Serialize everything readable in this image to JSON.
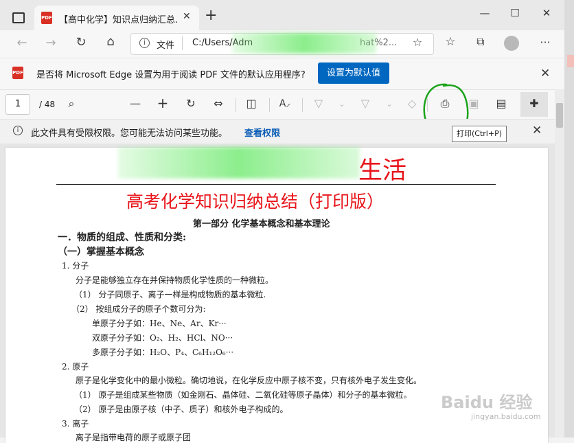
{
  "tab": {
    "title": "【高中化学】知识点归纳汇总.pdf",
    "new_tab": "+"
  },
  "window": {
    "minimize": "—",
    "maximize": "☐",
    "close": "✕"
  },
  "nav": {
    "back": "←",
    "forward": "→",
    "refresh": "↻",
    "home": "⌂",
    "file_label": "文件",
    "url": "C:/Users/Adm",
    "url_tail": "hat%2..."
  },
  "infobar": {
    "message": "是否将 Microsoft Edge 设置为用于阅读 PDF 文件的默认应用程序?",
    "button": "设置为默认值"
  },
  "pdfbar": {
    "page": "1",
    "total": "/ 48"
  },
  "restrict": {
    "message": "此文件具有受限权限。您可能无法访问某些功能。",
    "link": "查看权限"
  },
  "tooltip": "打印(Ctrl+P)",
  "document": {
    "header_visible": "生活",
    "title": "高考化学知识归纳总结（打印版）",
    "part": "第一部分 化学基本概念和基本理论",
    "section1": "一．物质的组成、性质和分类:",
    "section1_sub": "（一）掌握基本概念",
    "lines": [
      "1. 分子",
      "分子是能够独立存在并保持物质化学性质的一种微粒。",
      "（1） 分子同原子、离子一样是构成物质的基本微粒.",
      "（2） 按组成分子的原子个数可分为:",
      "单原子分子如：He、Ne、Ar、Kr···",
      "双原子分子如：O₂、H₂、HCl、NO···",
      "多原子分子如：H₂O、P₄、C₆H₁₂O₆···",
      "2. 原子",
      "原子是化学变化中的最小微粒。确切地说，在化学反应中原子核不变，只有核外电子发生变化。",
      "（1） 原子是组成某些物质（如金刚石、晶体硅、二氧化硅等原子晶体）和分子的基本微粒。",
      "（2） 原子是由原子核（中子、质子）和核外电子构成的。",
      "3. 离子",
      "离子是指带电荷的原子或原子团"
    ]
  },
  "watermark": {
    "main": "Baidu 经验",
    "sub": "jingyan.baidu.com"
  },
  "colors": {
    "accent": "#0067c0",
    "doc_red": "#e8141a",
    "annotation": "#1aa31a"
  }
}
